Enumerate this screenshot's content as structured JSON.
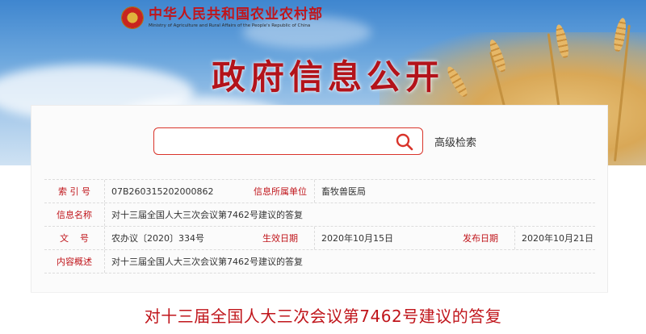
{
  "brand": {
    "name_cn": "中华人民共和国农业农村部",
    "name_en": "Ministry of Agriculture and Rural Affairs of the People's Republic of China"
  },
  "page_title": "政府信息公开",
  "search": {
    "placeholder": "",
    "advanced_label": "高级检索"
  },
  "info": {
    "index_label": "索 引 号",
    "index_value": "07B260315202000862",
    "dept_label": "信息所属单位",
    "dept_value": "畜牧兽医局",
    "name_label": "信息名称",
    "name_value": "对十三届全国人大三次会议第7462号建议的答复",
    "docno_label": "文    号",
    "docno_value": "农办议〔2020〕334号",
    "effective_label": "生效日期",
    "effective_value": "2020年10月15日",
    "publish_label": "发布日期",
    "publish_value": "2020年10月21日",
    "summary_label": "内容概述",
    "summary_value": "对十三届全国人大三次会议第7462号建议的答复"
  },
  "document_title": "对十三届全国人大三次会议第7462号建议的答复",
  "colors": {
    "accent": "#c0151b",
    "search_border": "#d9342b"
  }
}
